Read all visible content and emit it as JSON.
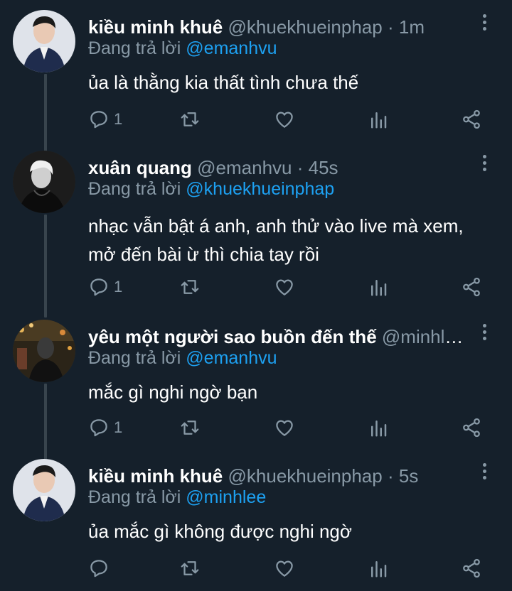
{
  "replying_prefix": "Đang trả lời",
  "tweets": [
    {
      "name": "kiều minh khuê",
      "handle": "@khuekhueinphap",
      "time": "1m",
      "reply_to": "@emanhvu",
      "text": "ủa là thằng kia thất tình chưa thế",
      "reply_count": "1"
    },
    {
      "name": "xuân quang",
      "handle": "@emanhvu",
      "time": "45s",
      "reply_to": "@khuekhueinphap",
      "text": "nhạc vẫn bật á anh, anh thử vào live mà xem, mở đến bài ừ thì chia tay rồi",
      "reply_count": "1"
    },
    {
      "name": "yêu một người sao buồn đến thế",
      "handle": "@minhlee",
      "time": "",
      "reply_to": "@emanhvu",
      "text": "mắc gì nghi ngờ bạn",
      "reply_count": "1"
    },
    {
      "name": "kiều minh khuê",
      "handle": "@khuekhueinphap",
      "time": "5s",
      "reply_to": "@minhlee",
      "text": "ủa mắc gì không được nghi ngờ",
      "reply_count": ""
    }
  ],
  "colors": {
    "background": "#15202b",
    "thread_line": "#38444d",
    "secondary_text": "#8899a6",
    "mention": "#1da1f2"
  }
}
